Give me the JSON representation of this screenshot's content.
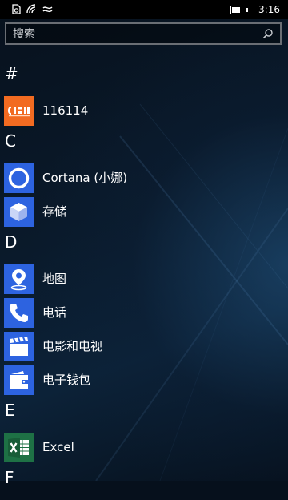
{
  "status_bar": {
    "time": "3:16",
    "battery_level_percent": 60,
    "icons": [
      "notification-icon",
      "wifi-icon",
      "data-sense-icon",
      "battery-icon"
    ]
  },
  "search": {
    "placeholder": "搜索",
    "icon": "search-icon"
  },
  "sections": [
    {
      "letter": "#",
      "apps": [
        {
          "label": "116114",
          "icon": "app-116114-icon",
          "tile_color": "#f26b21"
        }
      ]
    },
    {
      "letter": "C",
      "apps": [
        {
          "label": "Cortana (小娜)",
          "icon": "cortana-icon",
          "tile_color": "#2d63e0"
        },
        {
          "label": "存储",
          "icon": "storage-icon",
          "tile_color": "#2d63e0"
        }
      ]
    },
    {
      "letter": "D",
      "apps": [
        {
          "label": "地图",
          "icon": "maps-icon",
          "tile_color": "#2d63e0"
        },
        {
          "label": "电话",
          "icon": "phone-icon",
          "tile_color": "#2d63e0"
        },
        {
          "label": "电影和电视",
          "icon": "movies-tv-icon",
          "tile_color": "#2d63e0"
        },
        {
          "label": "电子钱包",
          "icon": "wallet-icon",
          "tile_color": "#2d63e0"
        }
      ]
    },
    {
      "letter": "E",
      "apps": [
        {
          "label": "Excel",
          "icon": "excel-icon",
          "tile_color": "#1e7145"
        }
      ]
    },
    {
      "letter": "F",
      "apps": []
    }
  ]
}
